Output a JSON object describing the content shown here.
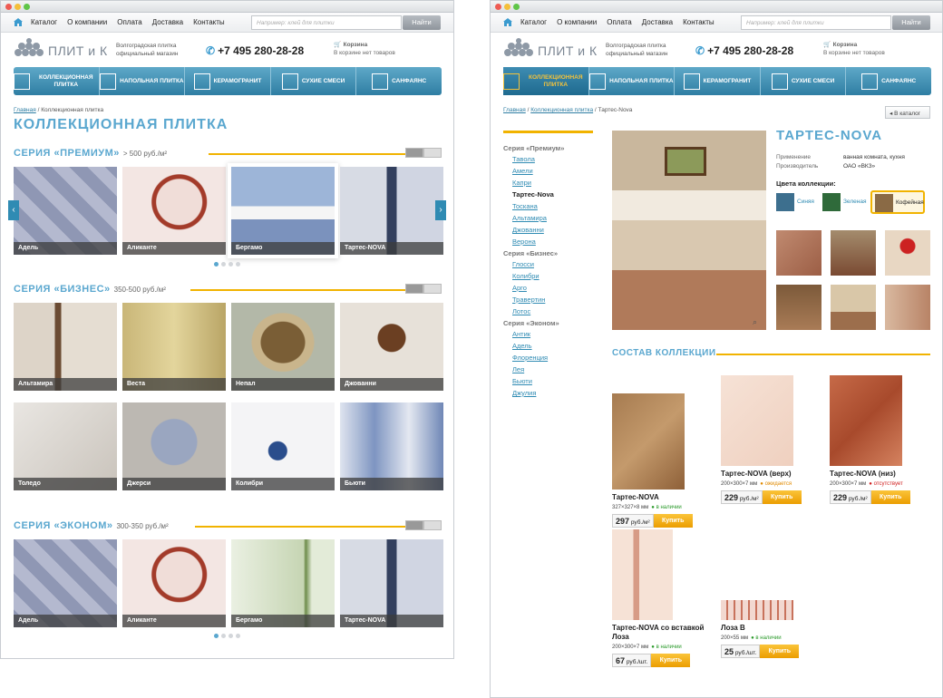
{
  "nav": {
    "links": [
      "Каталог",
      "О компании",
      "Оплата",
      "Доставка",
      "Контакты"
    ],
    "search_placeholder": "Например: клей для плитки",
    "search_button": "Найти"
  },
  "brand": {
    "name": "ПЛИТ и К",
    "tagline": "Волгоградская плитка официальный магазин",
    "phone": "+7 495 280-28-28",
    "cart_title": "Корзина",
    "cart_status": "В корзине нет товаров"
  },
  "menu": [
    {
      "label": "Коллекционная плитка"
    },
    {
      "label": "Напольная плитка"
    },
    {
      "label": "Керамогранит"
    },
    {
      "label": "Сухие смеси"
    },
    {
      "label": "Санфаянс"
    }
  ],
  "left": {
    "breadcrumb": {
      "home": "Главная",
      "sep": "/",
      "current": "Коллекционная плитка"
    },
    "title": "Коллекционная плитка",
    "sections": [
      {
        "name": "Серия «Премиум»",
        "price": "> 500 руб./м²",
        "tiles": [
          "Адель",
          "Аликанте",
          "Бергамо",
          "Тартес-NOVA"
        ]
      },
      {
        "name": "Серия «Бизнес»",
        "price": "350-500 руб./м²",
        "tiles": [
          "Альтамира",
          "Веста",
          "Непал",
          "Джованни",
          "Толедо",
          "Джерси",
          "Колибри",
          "Бьюти"
        ]
      },
      {
        "name": "Серия «Эконом»",
        "price": "300-350 руб./м²",
        "tiles": [
          "Адель",
          "Аликанте",
          "Бергамо",
          "Тартес-NOVA"
        ]
      }
    ]
  },
  "right": {
    "breadcrumb": {
      "home": "Главная",
      "mid": "Коллекционная плитка",
      "current": "Тартес-Nova",
      "sep": "/"
    },
    "back_button": "В каталог",
    "sidebar": [
      {
        "group": "Серия «Премиум»",
        "items": [
          "Тавола",
          "Амели",
          "Капри",
          "Тартес-Nova",
          "Тоскана",
          "Альтамира",
          "Джованни",
          "Верона"
        ],
        "current": "Тартес-Nova"
      },
      {
        "group": "Серия «Бизнес»",
        "items": [
          "Глосси",
          "Колибри",
          "Арго",
          "Травертин",
          "Лотос"
        ]
      },
      {
        "group": "Серия «Эконом»",
        "items": [
          "Антик",
          "Адель",
          "Флоренция",
          "Лея",
          "Бьюти",
          "Джулия"
        ]
      }
    ],
    "product_title": "Тартес-Nova",
    "spec": [
      {
        "k": "Применение",
        "v": "ванная комната, кухня"
      },
      {
        "k": "Производитель",
        "v": "ОАО «ВКЗ»"
      }
    ],
    "colors_label": "Цвета коллекции:",
    "colors": [
      {
        "name": "Синяя",
        "hex": "#3d6f8e"
      },
      {
        "name": "Зеленая",
        "hex": "#2f6a3a"
      },
      {
        "name": "Кофейная",
        "hex": "#8a6a45"
      }
    ],
    "section_title": "Состав коллекции",
    "currency": "руб./м²",
    "currency_unit": "руб./шт.",
    "buy": "Купить",
    "products": [
      {
        "name": "Тартес-NOVA",
        "size": "327×327×8 мм",
        "status": "в наличии",
        "price": "297"
      },
      {
        "name": "Тартес-NOVA (верх)",
        "size": "200×300×7 мм",
        "status": "ожидается",
        "price": "229"
      },
      {
        "name": "Тартес-NOVA (низ)",
        "size": "200×300×7 мм",
        "status": "отсутствует",
        "price": "229"
      },
      {
        "name": "Тартес-NOVA со вставкой Лоза",
        "size": "200×300×7 мм",
        "status": "в наличии",
        "price": "67"
      },
      {
        "name": "Лоза В",
        "size": "200×55 мм",
        "status": "в наличии",
        "price": "25"
      }
    ]
  }
}
